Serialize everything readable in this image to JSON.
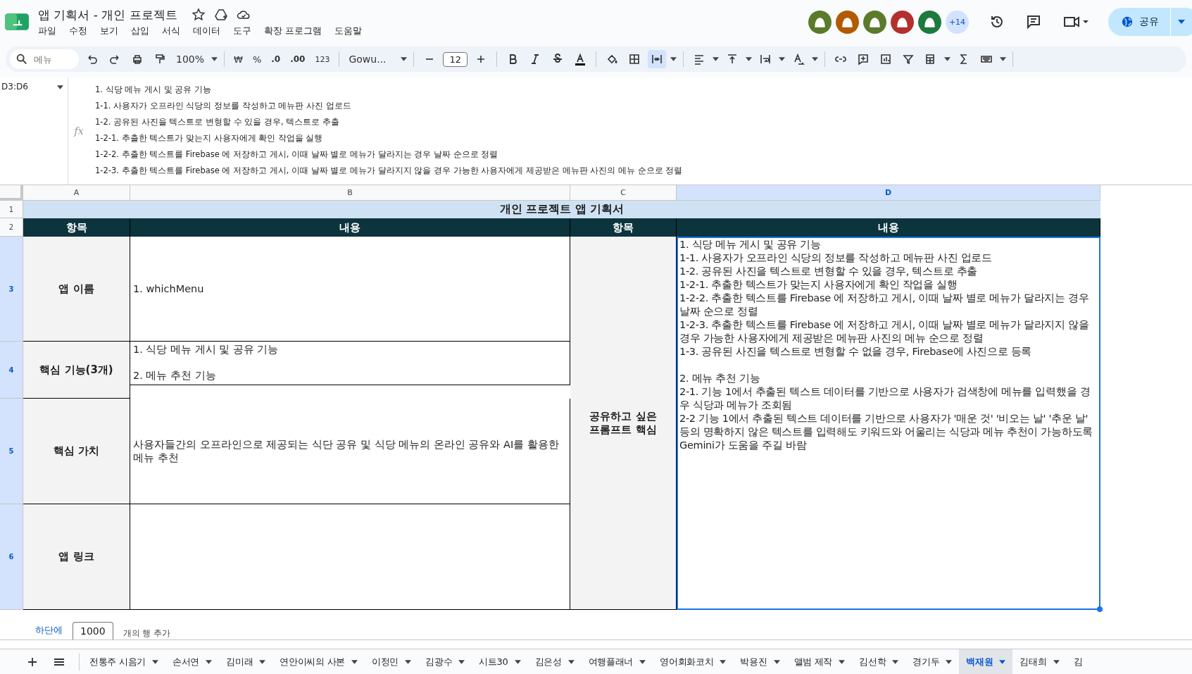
{
  "document": {
    "title": "앱 기획서 - 개인 프로젝트",
    "menu": [
      "파일",
      "수정",
      "보기",
      "삽입",
      "서식",
      "데이터",
      "도구",
      "확장 프로그램",
      "도움말"
    ]
  },
  "collaborators": {
    "avatars": [
      {
        "color": "#5b7a2b"
      },
      {
        "color": "#b35a00"
      },
      {
        "color": "#5b7a2b"
      },
      {
        "color": "#b3302e"
      },
      {
        "color": "#1e7a3c"
      }
    ],
    "more": "+14"
  },
  "share_button": "공유",
  "toolbar": {
    "search_placeholder": "메뉴",
    "zoom": "100%",
    "currency": "₩",
    "percent": "%",
    "decrease_decimal": ".0",
    "increase_decimal": ".00",
    "number_format": "123",
    "font": "Gowu...",
    "font_size": "12"
  },
  "formula_bar": {
    "cell_ref": "D3:D6",
    "fx_label": "fx",
    "lines": [
      "1. 식당 메뉴 게시 및 공유 기능",
      "1-1. 사용자가 오프라인 식당의 정보를 작성하고 메뉴판 사진 업로드",
      "1-2. 공유된 사진을 텍스트로 변형할 수 있을 경우, 텍스트로 추출",
      "1-2-1. 추출한 텍스트가 맞는지 사용자에게 확인 작업을 실행",
      "1-2-2. 추출한 텍스트를 Firebase 에 저장하고 게시, 이때 날짜 별로 메뉴가 달라지는 경우 날짜 순으로 정렬",
      "1-2-3. 추출한 텍스트를 Firebase 에 저장하고 게시, 이때 날짜 별로 메뉴가 달라지지 않을 경우 가능한 사용자에게 제공받은 메뉴판 사진의 메뉴 순으로 정렬"
    ]
  },
  "sheet": {
    "columns": [
      {
        "label": "A",
        "selected": false
      },
      {
        "label": "B",
        "selected": false
      },
      {
        "label": "C",
        "selected": false
      },
      {
        "label": "D",
        "selected": true
      }
    ],
    "row_numbers": [
      {
        "label": "1",
        "selected": false
      },
      {
        "label": "2",
        "selected": false
      },
      {
        "label": "3",
        "selected": true
      },
      {
        "label": "4",
        "selected": true
      },
      {
        "label": "5",
        "selected": true
      },
      {
        "label": "6",
        "selected": true
      }
    ],
    "title": "개인 프로젝트 앱 기획서",
    "headers": [
      "항목",
      "내용",
      "항목",
      "내용"
    ],
    "rows": [
      {
        "item": "앱 이름",
        "content": [
          "1. whichMenu"
        ]
      },
      {
        "item": "핵심 기능(3개)",
        "content": [
          "1. 식당 메뉴 게시 및 공유 기능",
          "2. 메뉴 추천 기능"
        ]
      },
      {
        "item": "핵심 가치",
        "content": [
          "사용자들간의 오프라인으로 제공되는 식단 공유 및 식당 메뉴의 온라인 공유와 AI를 활용한 메뉴 추천"
        ]
      },
      {
        "item": "앱 링크",
        "content": []
      }
    ],
    "merged_item": "공유하고 싶은 프롬프트 핵심",
    "merged_content": [
      [
        "1. 식당 메뉴 게시 및 공유 기능",
        "1-1. 사용자가 오프라인 식당의 정보를 작성하고 메뉴판 사진 업로드",
        "1-2. 공유된 사진을 텍스트로 변형할 수 있을 경우, 텍스트로 추출",
        "1-2-1. 추출한 텍스트가 맞는지 사용자에게 확인 작업을 실행",
        "1-2-2. 추출한 텍스트를 Firebase 에 저장하고 게시, 이때 날짜 별로 메뉴가 달라지는 경우 날짜 순으로 정렬",
        "1-2-3. 추출한 텍스트를 Firebase 에 저장하고 게시, 이때 날짜 별로 메뉴가 달라지지 않을 경우 가능한 사용자에게 제공받은 메뉴판 사진의 메뉴 순으로 정렬",
        "1-3. 공유된 사진을 텍스트로 변형할 수 없을 경우, Firebase에 사진으로 등록"
      ],
      [
        "2. 메뉴 추천 기능",
        "2-1. 기능 1에서 추출된 텍스트 데이터를 기반으로 사용자가 검색창에 메뉴를 입력했을 경우 식당과 메뉴가 조회됨",
        "2-2 기능 1에서 추출된 텍스트 데이터를 기반으로 사용자가 '매운 것' '비오는 날' '추운 날' 등의 명확하지 않은 텍스트를 입력해도 키워드와 어울리는 식당과 메뉴 추천이 가능하도록 Gemini가 도움을 주길 바람"
      ]
    ]
  },
  "add_rows": {
    "button": "하단에",
    "count": "1000",
    "label": "개의 행 추가"
  },
  "sheet_tabs": [
    {
      "label": "전통주 시음기",
      "selected": false
    },
    {
      "label": "손서연",
      "selected": false
    },
    {
      "label": "김미래",
      "selected": false
    },
    {
      "label": "연안이씨의 사본",
      "selected": false
    },
    {
      "label": "이정민",
      "selected": false
    },
    {
      "label": "김광수",
      "selected": false
    },
    {
      "label": "시트30",
      "selected": false
    },
    {
      "label": "김은성",
      "selected": false
    },
    {
      "label": "여행플래너",
      "selected": false
    },
    {
      "label": "영어회화코치",
      "selected": false
    },
    {
      "label": "박용진",
      "selected": false
    },
    {
      "label": "앨범 제작",
      "selected": false
    },
    {
      "label": "김선학",
      "selected": false
    },
    {
      "label": "경기두",
      "selected": false
    },
    {
      "label": "백재원",
      "selected": true
    },
    {
      "label": "김태희",
      "selected": false
    },
    {
      "label": "김",
      "selected": false
    }
  ]
}
